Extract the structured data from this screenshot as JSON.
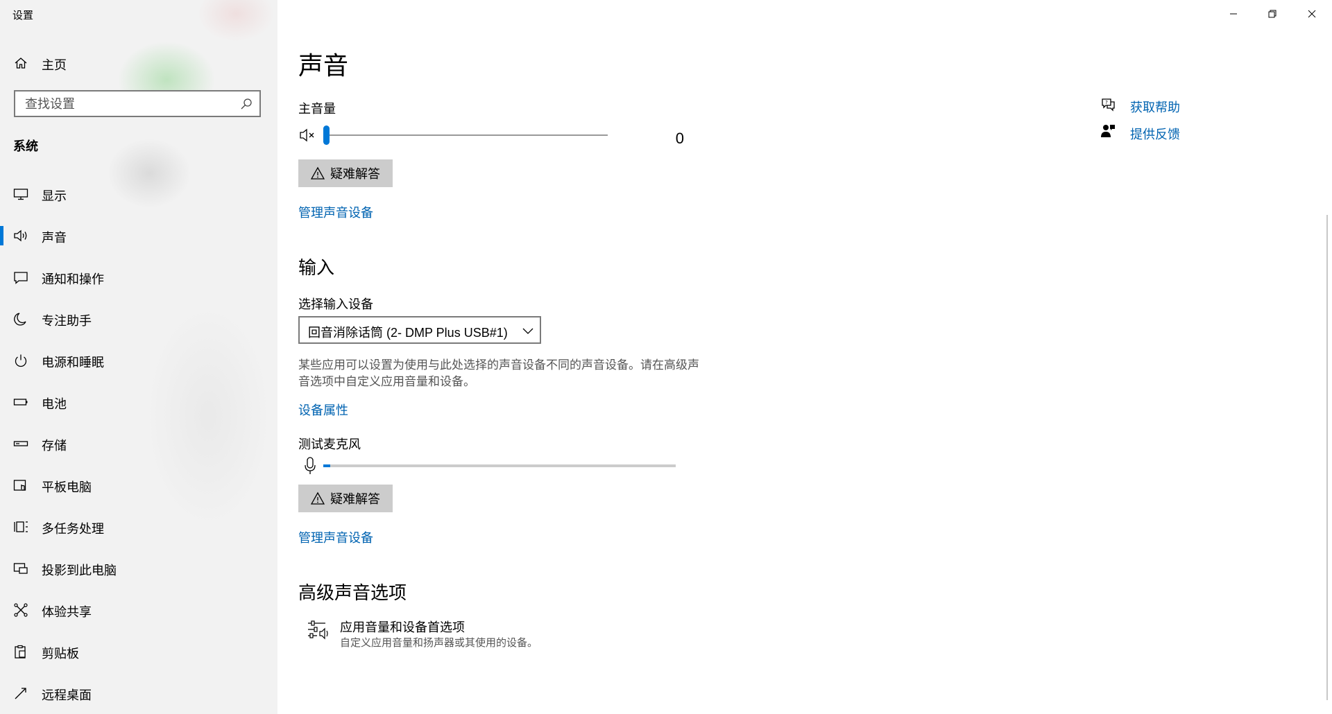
{
  "window": {
    "title": "设置",
    "controls": {
      "minimize": "minimize-icon",
      "restore": "restore-icon",
      "close": "close-icon"
    }
  },
  "sidebar": {
    "home_label": "主页",
    "search_placeholder": "查找设置",
    "section_title": "系统",
    "items": [
      {
        "label": "显示",
        "icon": "monitor-icon"
      },
      {
        "label": "声音",
        "icon": "speaker-icon",
        "active": true
      },
      {
        "label": "通知和操作",
        "icon": "notification-icon"
      },
      {
        "label": "专注助手",
        "icon": "moon-icon"
      },
      {
        "label": "电源和睡眠",
        "icon": "power-icon"
      },
      {
        "label": "电池",
        "icon": "battery-icon"
      },
      {
        "label": "存储",
        "icon": "storage-icon"
      },
      {
        "label": "平板电脑",
        "icon": "tablet-icon"
      },
      {
        "label": "多任务处理",
        "icon": "multitask-icon"
      },
      {
        "label": "投影到此电脑",
        "icon": "project-icon"
      },
      {
        "label": "体验共享",
        "icon": "share-icon"
      },
      {
        "label": "剪贴板",
        "icon": "clipboard-icon"
      },
      {
        "label": "远程桌面",
        "icon": "remote-desktop-icon"
      }
    ]
  },
  "main": {
    "title": "声音",
    "master_volume": {
      "label": "主音量",
      "value": "0",
      "level": 0
    },
    "troubleshoot_label": "疑难解答",
    "manage_devices_label": "管理声音设备",
    "input": {
      "heading": "输入",
      "select_label": "选择输入设备",
      "selected_device": "回音消除话筒 (2- DMP Plus USB#1)",
      "description": "某些应用可以设置为使用与此处选择的声音设备不同的声音设备。请在高级声音选项中自定义应用音量和设备。",
      "device_properties_label": "设备属性",
      "test_mic_label": "测试麦克风",
      "mic_level": 0.02
    },
    "advanced": {
      "heading": "高级声音选项",
      "app_volume_title": "应用音量和设备首选项",
      "app_volume_desc": "自定义应用音量和扬声器或其使用的设备。"
    },
    "help": {
      "get_help": "获取帮助",
      "feedback": "提供反馈"
    }
  },
  "colors": {
    "accent": "#0078d7",
    "link": "#0063b1",
    "button_bg": "#cccccc"
  }
}
